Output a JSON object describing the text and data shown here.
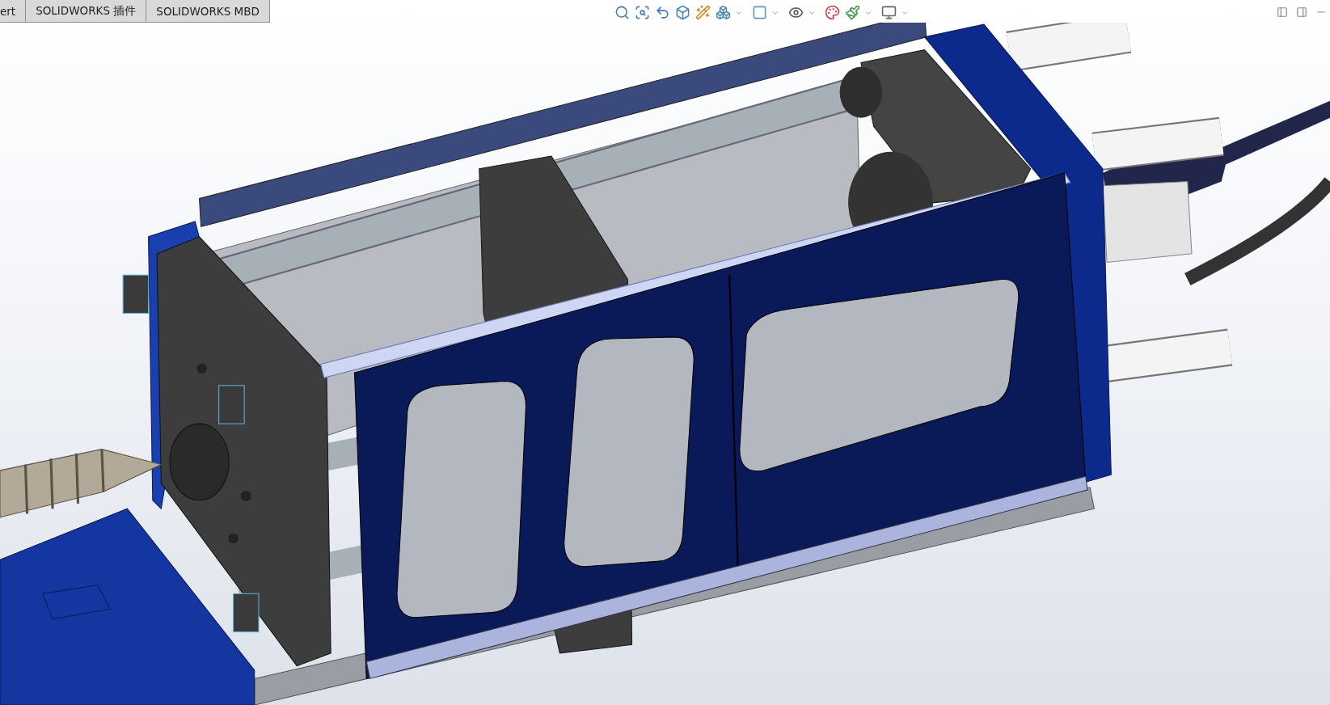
{
  "command_manager": {
    "tabs": [
      {
        "label": "ert"
      },
      {
        "label": "SOLIDWORKS 插件"
      },
      {
        "label": "SOLIDWORKS MBD"
      }
    ]
  }
}
